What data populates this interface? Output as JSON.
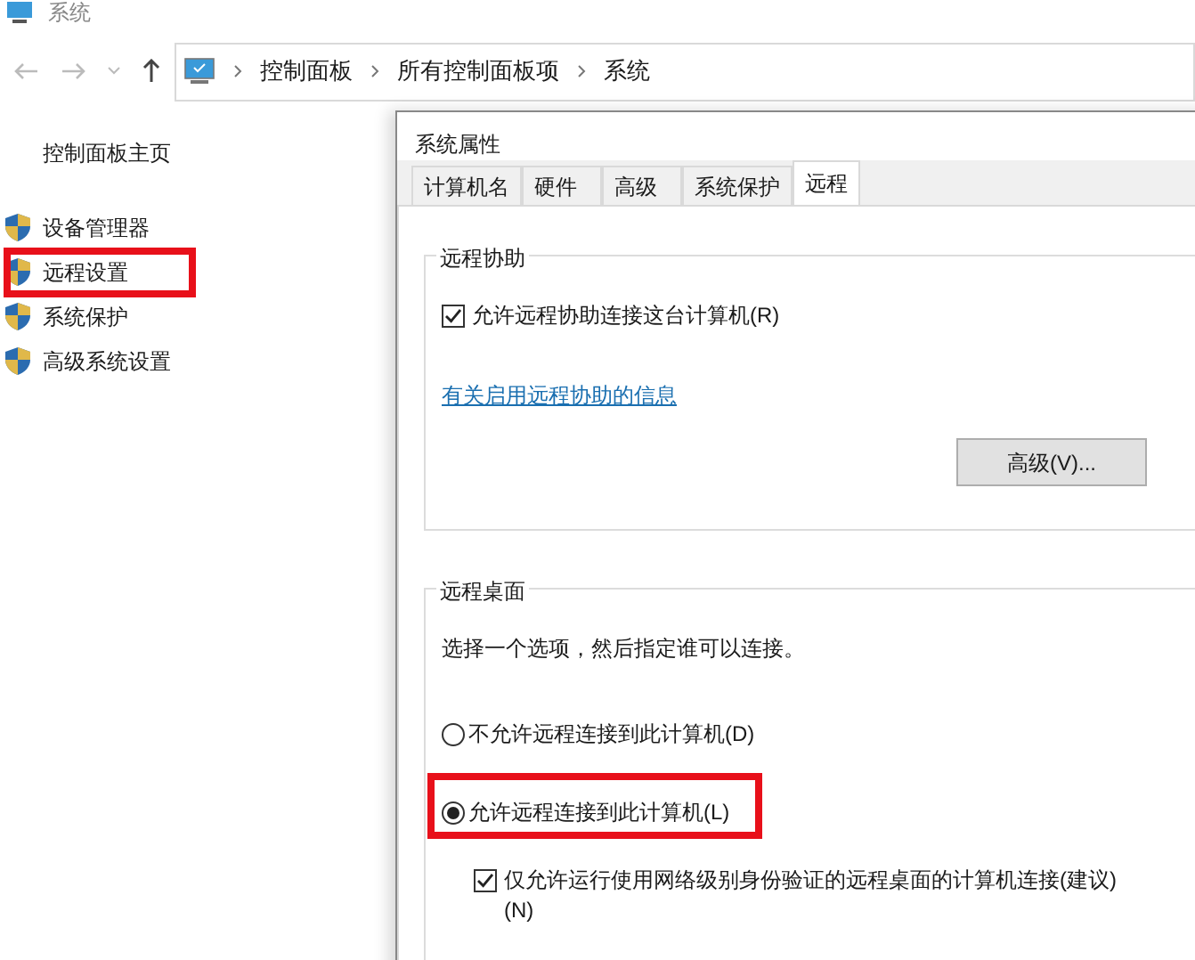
{
  "window": {
    "title": "系统"
  },
  "address_bar": {
    "crumbs": [
      "控制面板",
      "所有控制面板项",
      "系统"
    ]
  },
  "sidebar": {
    "home": "控制面板主页",
    "items": [
      {
        "label": "设备管理器",
        "highlighted": false
      },
      {
        "label": "远程设置",
        "highlighted": true
      },
      {
        "label": "系统保护",
        "highlighted": false
      },
      {
        "label": "高级系统设置",
        "highlighted": false
      }
    ]
  },
  "dialog": {
    "title": "系统属性",
    "tabs": [
      {
        "label": "计算机名",
        "selected": false
      },
      {
        "label": "硬件",
        "selected": false
      },
      {
        "label": "高级",
        "selected": false
      },
      {
        "label": "系统保护",
        "selected": false
      },
      {
        "label": "远程",
        "selected": true
      }
    ],
    "remote_assistance": {
      "title": "远程协助",
      "checkbox": {
        "label": "允许远程协助连接这台计算机(R)",
        "checked": true
      },
      "link": "有关启用远程协助的信息",
      "button": "高级(V)..."
    },
    "remote_desktop": {
      "title": "远程桌面",
      "hint": "选择一个选项，然后指定谁可以连接。",
      "options": [
        {
          "label": "不允许远程连接到此计算机(D)",
          "selected": false,
          "highlighted": false
        },
        {
          "label": "允许远程连接到此计算机(L)",
          "selected": true,
          "highlighted": true
        }
      ],
      "nla_checkbox": {
        "label": "仅允许运行使用网络级别身份验证的远程桌面的计算机连接(建议)(N)",
        "checked": true
      }
    }
  }
}
